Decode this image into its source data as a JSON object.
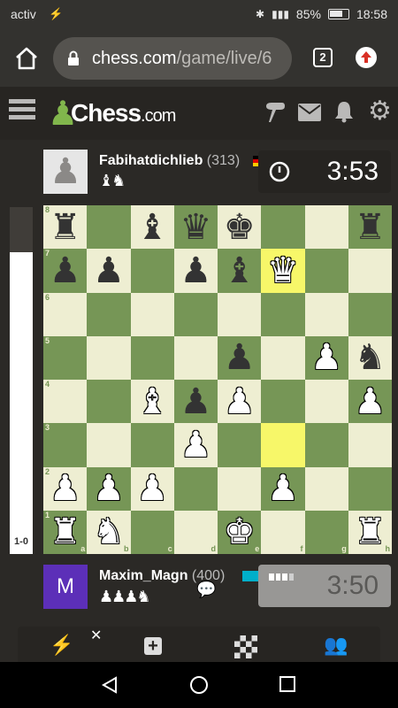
{
  "status_bar": {
    "carrier": "activ",
    "battery": "85%",
    "time": "18:58"
  },
  "browser": {
    "url_domain": "chess.com",
    "url_path": "/game/live/6",
    "tab_count": "2"
  },
  "site": {
    "logo_main": "Chess",
    "logo_suffix": ".com"
  },
  "top_player": {
    "name": "Fabihatdichlieb",
    "rating": "(313)",
    "captured": "♝♞",
    "clock": "3:53"
  },
  "bottom_player": {
    "name": "Maxim_Magn",
    "rating": "(400)",
    "avatar_letter": "M",
    "captured": "♟♟♟♞",
    "clock": "3:50"
  },
  "eval": {
    "label": "1-0",
    "white_share": 0.87
  },
  "board": {
    "ranks": [
      "8",
      "7",
      "6",
      "5",
      "4",
      "3",
      "2",
      "1"
    ],
    "files": [
      "a",
      "b",
      "c",
      "d",
      "e",
      "f",
      "g",
      "h"
    ],
    "position": [
      [
        "br",
        "",
        "bb",
        "bq",
        "bk",
        "",
        "",
        "br"
      ],
      [
        "bp",
        "bp",
        "",
        "bp",
        "bb",
        "wq",
        "",
        ""
      ],
      [
        "",
        "",
        "",
        "",
        "",
        "",
        "",
        ""
      ],
      [
        "",
        "",
        "",
        "",
        "bp",
        "",
        "wp",
        "bn"
      ],
      [
        "",
        "",
        "wb",
        "bp",
        "wp",
        "",
        "",
        "wp"
      ],
      [
        "",
        "",
        "",
        "wp",
        "",
        "",
        "",
        ""
      ],
      [
        "wp",
        "wp",
        "wp",
        "",
        "",
        "wp",
        "",
        ""
      ],
      [
        "wr",
        "wn",
        "",
        "",
        "wk",
        "",
        "",
        "wr"
      ]
    ],
    "highlighted": [
      "f7",
      "f3"
    ]
  },
  "colors": {
    "light_square": "#eeeed2",
    "dark_square": "#769656",
    "highlight": "#f7f769",
    "avatar_purple": "#5c2fb8",
    "active_clock_bg": "#262421",
    "inactive_clock_bg": "#989795"
  },
  "icons": [
    "home-icon",
    "lock-icon",
    "tabs-icon",
    "menu-upload-icon",
    "hamburger-icon",
    "pawn-logo-icon",
    "messages-icon",
    "mail-icon",
    "bell-icon",
    "gear-icon",
    "clock-icon",
    "chat-icon",
    "flag-icon",
    "lightning-icon",
    "plus-icon",
    "board-icon",
    "friends-icon",
    "back-icon",
    "home-circle-icon",
    "recents-icon"
  ]
}
